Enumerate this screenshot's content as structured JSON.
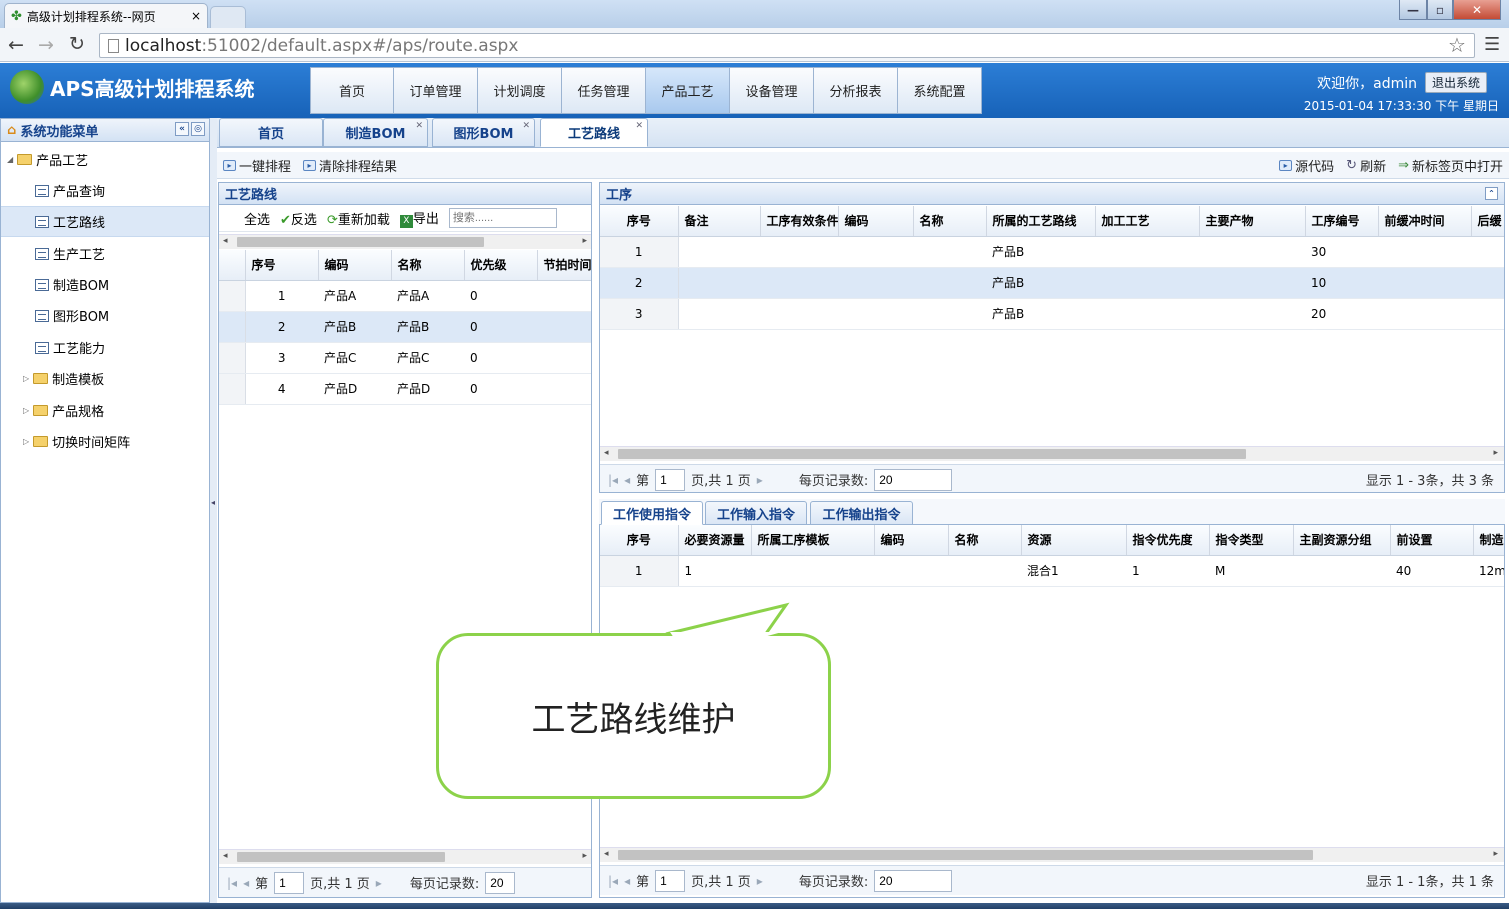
{
  "browser": {
    "tab_title": "高级计划排程系统--网页",
    "tab_close": "×",
    "url_host": "localhost",
    "url_rest": ":51002/default.aspx#/aps/route.aspx",
    "win_min": "—",
    "win_max": "▫",
    "win_close": "✕"
  },
  "app": {
    "title": "APS高级计划排程系统",
    "welcome": "欢迎你，admin",
    "logout": "退出系统",
    "datetime": "2015-01-04 17:33:30 下午 星期日"
  },
  "nav": [
    "首页",
    "订单管理",
    "计划调度",
    "任务管理",
    "产品工艺",
    "设备管理",
    "分析报表",
    "系统配置"
  ],
  "nav_active": 4,
  "sidebar": {
    "title": "系统功能菜单",
    "items": [
      {
        "label": "产品工艺",
        "type": "folder",
        "expanded": true
      },
      {
        "label": "产品查询",
        "type": "doc"
      },
      {
        "label": "工艺路线",
        "type": "doc",
        "selected": true
      },
      {
        "label": "生产工艺",
        "type": "doc"
      },
      {
        "label": "制造BOM",
        "type": "doc"
      },
      {
        "label": "图形BOM",
        "type": "doc"
      },
      {
        "label": "工艺能力",
        "type": "doc"
      },
      {
        "label": "制造模板",
        "type": "folder"
      },
      {
        "label": "产品规格",
        "type": "folder"
      },
      {
        "label": "切换时间矩阵",
        "type": "folder"
      }
    ]
  },
  "content_tabs": [
    "首页",
    "制造BOM",
    "图形BOM",
    "工艺路线"
  ],
  "toolbar": {
    "schedule": "一键排程",
    "clear": "清除排程结果",
    "source": "源代码",
    "refresh": "刷新",
    "open_new": "新标签页中打开"
  },
  "route_panel": {
    "title": "工艺路线",
    "actions": {
      "select_all": "全选",
      "invert": "反选",
      "reload": "重新加载",
      "export": "导出"
    },
    "search_placeholder": "搜索......",
    "columns": [
      "序号",
      "编码",
      "名称",
      "优先级",
      "节拍时间"
    ],
    "rows": [
      [
        "1",
        "产品A",
        "产品A",
        "0",
        ""
      ],
      [
        "2",
        "产品B",
        "产品B",
        "0",
        ""
      ],
      [
        "3",
        "产品C",
        "产品C",
        "0",
        ""
      ],
      [
        "4",
        "产品D",
        "产品D",
        "0",
        ""
      ]
    ],
    "selected_row": 1,
    "pager": {
      "page_label": "第",
      "page": "1",
      "of_label": "页,共 1 页",
      "size_label": "每页记录数:",
      "size": "20"
    }
  },
  "process_panel": {
    "title": "工序",
    "columns": [
      "序号",
      "备注",
      "工序有效条件",
      "编码",
      "名称",
      "所属的工艺路线",
      "加工工艺",
      "主要产物",
      "工序编号",
      "前缓冲时间",
      "后缓"
    ],
    "rows": [
      [
        "1",
        "",
        "",
        "",
        "",
        "产品B",
        "",
        "",
        "30",
        "",
        ""
      ],
      [
        "2",
        "",
        "",
        "",
        "",
        "产品B",
        "",
        "",
        "10",
        "",
        ""
      ],
      [
        "3",
        "",
        "",
        "",
        "",
        "产品B",
        "",
        "",
        "20",
        "",
        ""
      ]
    ],
    "selected_row": 1,
    "pager": {
      "page_label": "第",
      "page": "1",
      "of_label": "页,共 1 页",
      "size_label": "每页记录数:",
      "size": "20",
      "summary": "显示 1 - 3条，共 3 条"
    }
  },
  "instruction_panel": {
    "tabs": [
      "工作使用指令",
      "工作输入指令",
      "工作输出指令"
    ],
    "columns": [
      "序号",
      "必要资源量",
      "所属工序模板",
      "编码",
      "名称",
      "资源",
      "指令优先度",
      "指令类型",
      "主副资源分组",
      "前设置",
      "制造"
    ],
    "rows": [
      [
        "1",
        "1",
        "",
        "",
        "",
        "混合1",
        "1",
        "M",
        "",
        "40",
        "12m"
      ]
    ],
    "pager": {
      "page_label": "第",
      "page": "1",
      "of_label": "页,共 1 页",
      "size_label": "每页记录数:",
      "size": "20",
      "summary": "显示 1 - 1条，共 1 条"
    }
  },
  "callout": "工艺路线维护"
}
